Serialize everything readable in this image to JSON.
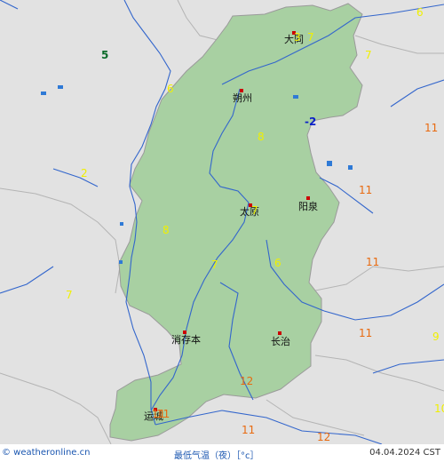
{
  "colors": {
    "background": "#e2e2e2",
    "province_fill": "#a8d0a2",
    "border": "#aaaaaa",
    "river": "#3366cc",
    "lake": "#2f7ad6",
    "city_marker": "#cc0000",
    "temp_yellow": "#f0f000",
    "temp_orange": "#e86a10",
    "temp_green": "#0b6b2a",
    "temp_blue": "#0b20c8"
  },
  "cities": [
    {
      "id": "datong",
      "name": "大同"
    },
    {
      "id": "shuozhou",
      "name": "朔州"
    },
    {
      "id": "taiyuan",
      "name": "太原"
    },
    {
      "id": "yangquan",
      "name": "阳泉"
    },
    {
      "id": "xiaoyi",
      "name": "消存本"
    },
    {
      "id": "changzhi",
      "name": "长治"
    },
    {
      "id": "yuncheng",
      "name": "运城"
    }
  ],
  "temperatures": [
    {
      "value": "5",
      "color": "green"
    },
    {
      "value": "6",
      "color": "yellow"
    },
    {
      "value": "7",
      "color": "yellow"
    },
    {
      "value": "3",
      "color": "yellow"
    },
    {
      "value": "8",
      "color": "yellow"
    },
    {
      "value": "-2",
      "color": "blue"
    },
    {
      "value": "11",
      "color": "orange"
    },
    {
      "value": "11",
      "color": "orange"
    },
    {
      "value": "2",
      "color": "yellow"
    },
    {
      "value": "7",
      "color": "yellow"
    },
    {
      "value": "8",
      "color": "yellow"
    },
    {
      "value": "7",
      "color": "yellow"
    },
    {
      "value": "6",
      "color": "yellow"
    },
    {
      "value": "11",
      "color": "orange"
    },
    {
      "value": "7",
      "color": "yellow"
    },
    {
      "value": "11",
      "color": "orange"
    },
    {
      "value": "9",
      "color": "yellow"
    },
    {
      "value": "12",
      "color": "orange"
    },
    {
      "value": "11",
      "color": "orange"
    },
    {
      "value": "11",
      "color": "orange"
    },
    {
      "value": "12",
      "color": "orange"
    },
    {
      "value": "10",
      "color": "yellow"
    },
    {
      "value": "6",
      "color": "yellow"
    },
    {
      "value": "7",
      "color": "yellow"
    },
    {
      "value": "11",
      "color": "orange"
    }
  ],
  "footer": {
    "copyright": "© weatheronline.cn",
    "legend": "最低气温（夜）［°c］",
    "date": "04.04.2024 CST"
  }
}
